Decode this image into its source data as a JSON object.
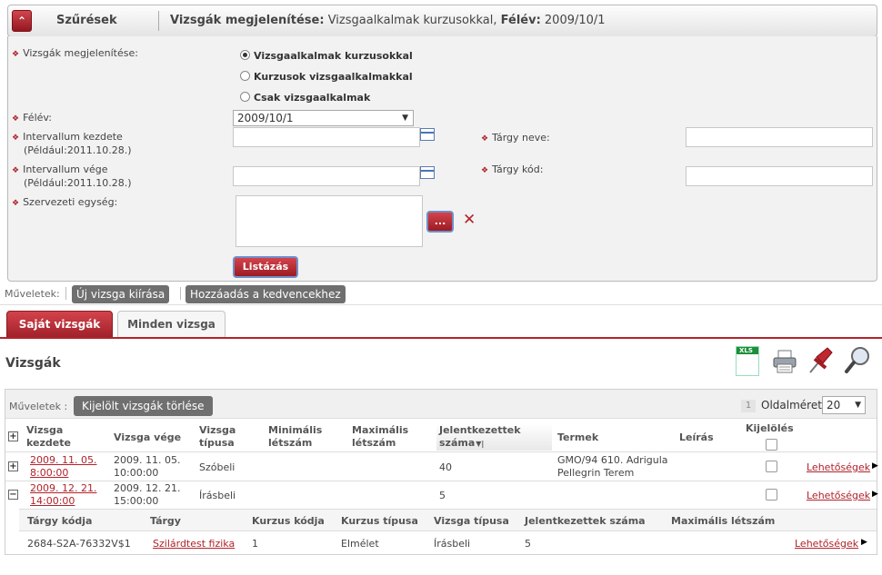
{
  "header": {
    "title": "Szűrések",
    "summary_label1": "Vizsgák megjelenítése:",
    "summary_value1": " Vizsgaalkalmak kurzusokkal, ",
    "summary_label2": "Félév:",
    "summary_value2": " 2009/10/1"
  },
  "filter": {
    "display_label": "Vizsgák megjelenítése:",
    "options": [
      "Vizsgaalkalmak kurzusokkal",
      "Kurzusok vizsgaalkalmakkal",
      "Csak vizsgaalkalmak"
    ],
    "semester_label": "Félév:",
    "semester_value": "2009/10/1",
    "start_label": "Intervallum kezdete",
    "start_hint": "(Például:2011.10.28.)",
    "end_label": "Intervallum vége",
    "end_hint": "(Például:2011.10.28.)",
    "subject_name_label": "Tárgy neve:",
    "subject_code_label": "Tárgy kód:",
    "org_unit_label": "Szervezeti egység:",
    "ellipsis_label": "...",
    "list_button": "Listázás"
  },
  "operations": {
    "label": "Műveletek:",
    "new_exam": "Új vizsga kiírása",
    "add_favorites": "Hozzáadás a kedvencekhez"
  },
  "tabs": {
    "own": "Saját vizsgák",
    "all": "Minden vizsga"
  },
  "section_title": "Vizsgák",
  "grid": {
    "ops_label": "Műveletek :",
    "delete_selected": "Kijelölt vizsgák törlése",
    "page_number": "1",
    "page_size_label": "Oldalméret",
    "page_size_value": "20",
    "headers": {
      "start1": "Vizsga",
      "start2": "kezdete",
      "end": "Vizsga vége",
      "type1": "Vizsga",
      "type2": "típusa",
      "min1": "Minimális",
      "min2": "létszám",
      "max1": "Maximális",
      "max2": "létszám",
      "reg1": "Jelentkezettek",
      "reg2": "száma",
      "rooms": "Termek",
      "desc": "Leírás",
      "select": "Kijelölés"
    },
    "rows": [
      {
        "start1": "2009. 11. 05.",
        "start2": "8:00:00",
        "end1": "2009. 11. 05.",
        "end2": "10:00:00",
        "type": "Szóbeli",
        "registered": "40",
        "room1": "GMO/94 610. Adrigula",
        "room2": "Pellegrin Terem",
        "options": "Lehetőségek"
      },
      {
        "start1": "2009. 12. 21.",
        "start2": "14:00:00",
        "end1": "2009. 12. 21.",
        "end2": "15:00:00",
        "type": "Írásbeli",
        "registered": "5",
        "options": "Lehetőségek"
      }
    ],
    "sub_headers": {
      "code": "Tárgy kódja",
      "subject": "Tárgy",
      "course_code": "Kurzus kódja",
      "course_type": "Kurzus típusa",
      "exam_type": "Vizsga típusa",
      "registered": "Jelentkezettek száma",
      "max": "Maximális létszám"
    },
    "sub_row": {
      "code": "2684-S2A-76332V$1",
      "subject": "Szilárdtest fizika",
      "course_code": "1",
      "course_type": "Elmélet",
      "exam_type": "Írásbeli",
      "registered": "5",
      "options": "Lehetőségek"
    }
  },
  "colors": {
    "accent": "#b0232b",
    "panel": "#f2f2f2"
  }
}
